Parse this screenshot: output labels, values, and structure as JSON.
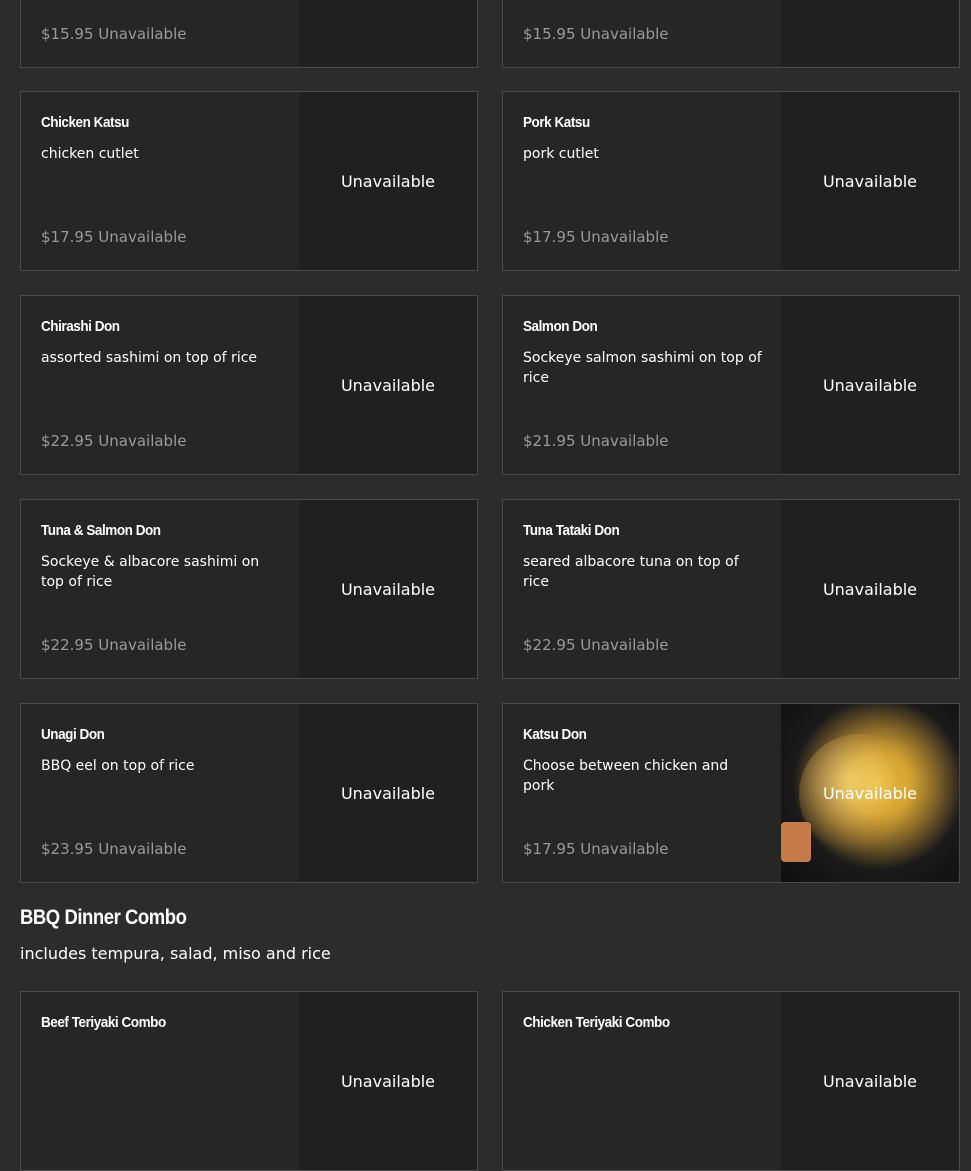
{
  "unavailable_label": "Unavailable",
  "cards": {
    "top_left": {
      "price": "$15.95",
      "status": "Unavailable",
      "media_status": ""
    },
    "top_right": {
      "price": "$15.95",
      "status": "Unavailable",
      "media_status": ""
    },
    "chicken_katsu": {
      "name": "Chicken Katsu",
      "desc": "chicken cutlet",
      "price": "$17.95",
      "status": "Unavailable",
      "media_status": "Unavailable"
    },
    "pork_katsu": {
      "name": "Pork Katsu",
      "desc": "pork cutlet",
      "price": "$17.95",
      "status": "Unavailable",
      "media_status": "Unavailable"
    },
    "chirashi_don": {
      "name": "Chirashi Don",
      "desc": "assorted sashimi on top of rice",
      "price": "$22.95",
      "status": "Unavailable",
      "media_status": "Unavailable"
    },
    "salmon_don": {
      "name": "Salmon Don",
      "desc": "Sockeye salmon sashimi on top of rice",
      "price": "$21.95",
      "status": "Unavailable",
      "media_status": "Unavailable"
    },
    "tuna_salmon_don": {
      "name": "Tuna & Salmon Don",
      "desc": "Sockeye & albacore sashimi on top of rice",
      "price": "$22.95",
      "status": "Unavailable",
      "media_status": "Unavailable"
    },
    "tuna_tataki_don": {
      "name": "Tuna Tataki Don",
      "desc": "seared albacore tuna on top of rice",
      "price": "$22.95",
      "status": "Unavailable",
      "media_status": "Unavailable"
    },
    "unagi_don": {
      "name": "Unagi Don",
      "desc": "BBQ eel on top of rice",
      "price": "$23.95",
      "status": "Unavailable",
      "media_status": "Unavailable"
    },
    "katsu_don": {
      "name": "Katsu Don",
      "desc": "Choose between chicken and pork",
      "price": "$17.95",
      "status": "Unavailable",
      "media_status": "Unavailable"
    },
    "beef_teriyaki_combo": {
      "name": "Beef Teriyaki Combo",
      "media_status": "Unavailable"
    },
    "chicken_teriyaki_combo": {
      "name": "Chicken Teriyaki Combo",
      "media_status": "Unavailable"
    }
  },
  "bbq_section": {
    "title": "BBQ Dinner Combo",
    "subtitle": "includes tempura, salad, miso and rice"
  }
}
